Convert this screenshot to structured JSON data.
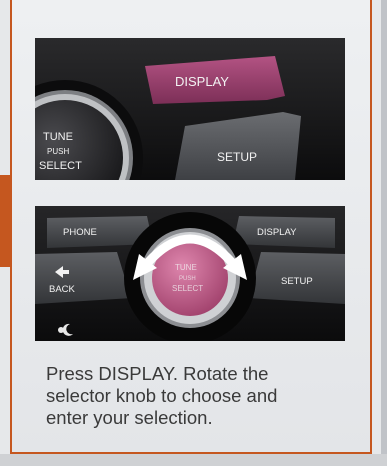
{
  "panel_top": {
    "display_button": "DISPLAY",
    "setup_button": "SETUP",
    "knob_tune": "TUNE",
    "knob_push": "PUSH",
    "knob_select": "SELECT"
  },
  "panel_bottom": {
    "phone_button": "PHONE",
    "display_button": "DISPLAY",
    "setup_button": "SETUP",
    "back_button": "BACK",
    "knob_tune": "TUNE",
    "knob_push": "PUSH",
    "knob_select": "SELECT"
  },
  "icons": {
    "rotate_arrows": "double-headed-curved-arrow-icon",
    "back_arrow": "return-arrow-icon",
    "brightness": "sun-moon-icon"
  },
  "colors": {
    "frame_border": "#c5571f",
    "highlight_button": "#a0406a",
    "knob_highlight": "#c6628e",
    "caption_text": "#3a3a3a"
  },
  "caption": {
    "line1": "Press DISPLAY. Rotate the",
    "line2": "selector knob to choose and",
    "line3": "enter your selection."
  }
}
